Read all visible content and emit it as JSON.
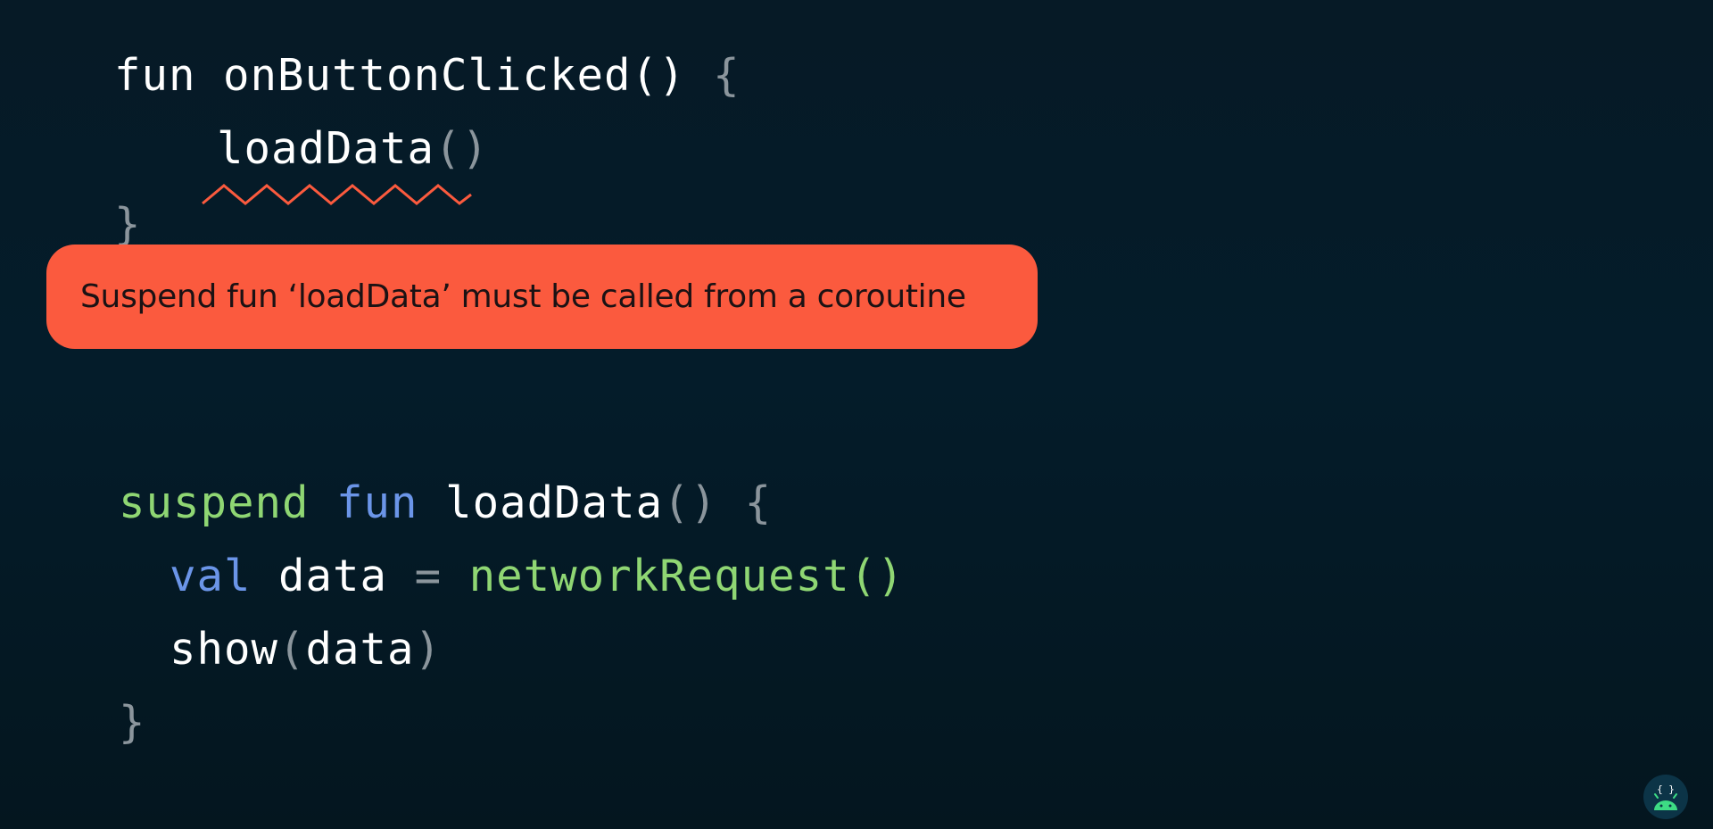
{
  "code": {
    "line1": {
      "kw_fun": "fun",
      "name": "onButtonClicked()",
      "brace": "{"
    },
    "line2": {
      "call": "loadData",
      "parens": "()"
    },
    "line3": {
      "brace": "}"
    },
    "line4": {
      "kw_suspend": "suspend",
      "kw_fun": "fun",
      "name": "loadData",
      "parens": "()",
      "brace": "{"
    },
    "line5": {
      "kw_val": "val",
      "var": "data",
      "eq": "=",
      "call": "networkRequest()"
    },
    "line6": {
      "call": "show",
      "lparen": "(",
      "arg": "data",
      "rparen": ")"
    },
    "line7": {
      "brace": "}"
    }
  },
  "error": {
    "message": "Suspend fun ‘loadData’ must be called from a coroutine"
  },
  "badge": {
    "icon": "android-code-icon",
    "glyph": "{ }"
  },
  "colors": {
    "background": "#051b27",
    "text": "#ffffff",
    "punctuation": "#8b959c",
    "suspend_keyword": "#8fd673",
    "keyword": "#6b95e8",
    "error": "#fb5a3e",
    "android_green": "#3ddc84"
  }
}
